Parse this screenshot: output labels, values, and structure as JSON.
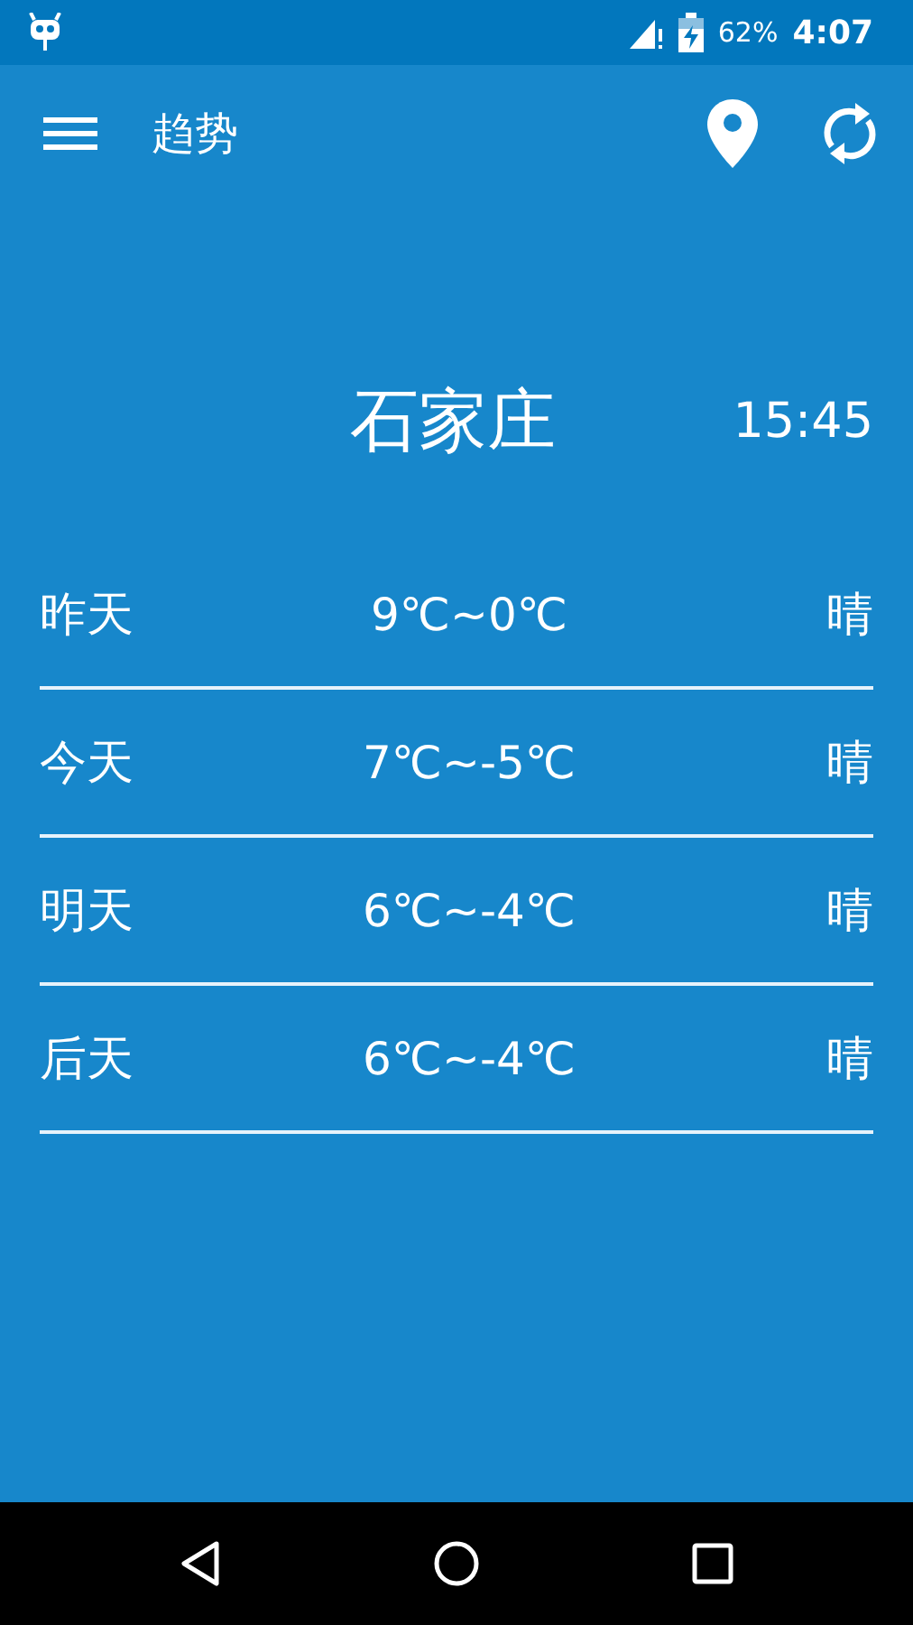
{
  "status_bar": {
    "battery": "62%",
    "time": "4:07"
  },
  "app_bar": {
    "title": "趋势"
  },
  "city": "石家庄",
  "updated": "15:45",
  "days": [
    {
      "day": "昨天",
      "temp": "9℃~0℃",
      "weather": "晴"
    },
    {
      "day": "今天",
      "temp": "7℃~-5℃",
      "weather": "晴"
    },
    {
      "day": "明天",
      "temp": "6℃~-4℃",
      "weather": "晴"
    },
    {
      "day": "后天",
      "temp": "6℃~-4℃",
      "weather": "晴"
    }
  ]
}
